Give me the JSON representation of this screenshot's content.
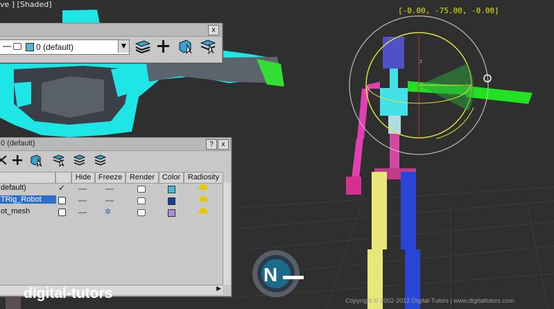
{
  "viewport": {
    "label": "ve ] [Shaded]",
    "coordinate_readout": "[-0.00, -75.00, -0.00]",
    "gizmo_axis_label": "z"
  },
  "layer_toolbar": {
    "current_layer": "0 (default)",
    "current_layer_color": "#56b6d6",
    "close_label": "x"
  },
  "layer_manager": {
    "title": "0 (default)",
    "help_label": "?",
    "close_label": "x",
    "columns": [
      "Hide",
      "Freeze",
      "Render",
      "Color",
      "Radiosity"
    ],
    "rows": [
      {
        "name": "default)",
        "active_check": "✓",
        "color": "#4ab7d3",
        "selected": false
      },
      {
        "name": "TRig_Robot",
        "active_check": "",
        "color": "#1b3d8f",
        "selected": true
      },
      {
        "name": "ot_mesh",
        "active_check": "",
        "color": "#a98fd8",
        "selected": false
      }
    ],
    "scroll_right_arrow": "▶"
  },
  "branding": {
    "watermark": "digital-tutors",
    "copyright": "Copyright © 2002-2012 Digital-Tutors  |  www.digitaltutors.com"
  },
  "colors": {
    "rig_head": "#5050c8",
    "rig_torso": "#44e2e8",
    "rig_left_arm": "#e040b0",
    "rig_right_arm": "#22e022",
    "rig_left_leg": "#e8e87a",
    "rig_right_leg": "#2846d6",
    "gizmo_ring": "#e0e040",
    "robot_mesh": "#1ee6e6"
  }
}
